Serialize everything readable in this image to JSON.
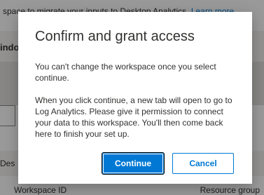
{
  "background": {
    "top_text": "space to migrate your inputs to Desktop Analytics.",
    "top_link": "Learn more",
    "window_label": "indo",
    "des_label": "Des",
    "col_workspace": "Workspace ID",
    "col_resource": "Resource group"
  },
  "dialog": {
    "title": "Confirm and grant access",
    "paragraph1": "You can't change the workspace once you select continue.",
    "paragraph2": "When you click continue, a new tab will open to go to Log Analytics. Please give it permission to connect your data to this workspace. You'll then come back here to finish your set up.",
    "continue_label": "Continue",
    "cancel_label": "Cancel"
  },
  "colors": {
    "accent": "#0078d4",
    "overlay": "rgba(0,0,0,0.40)"
  }
}
